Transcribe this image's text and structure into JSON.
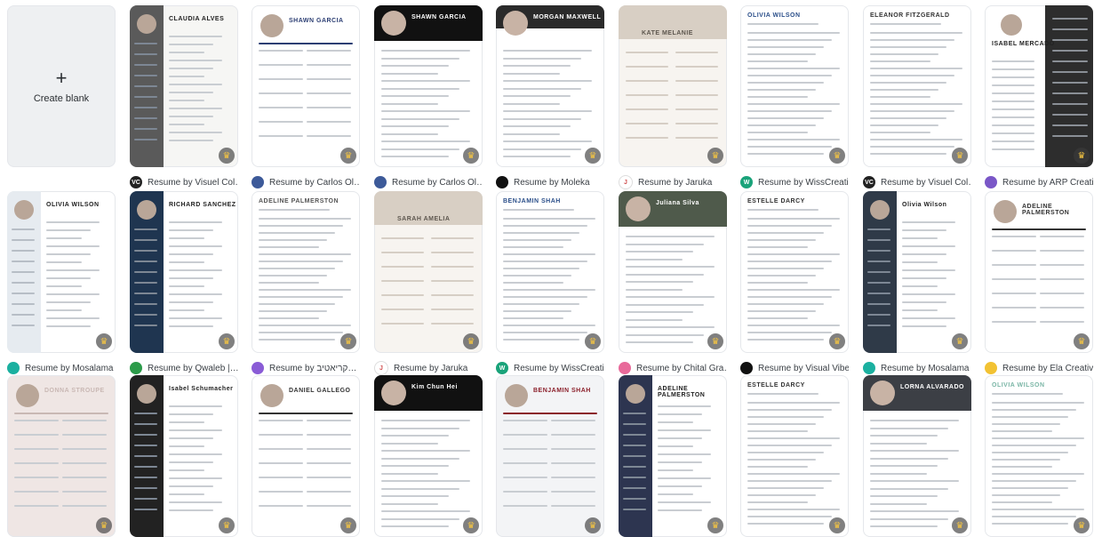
{
  "create_blank": {
    "plus": "+",
    "label": "Create blank"
  },
  "rows": [
    [
      {
        "caption": "Resume by Visuel Col…",
        "name": "CLAUDIA ALVES",
        "bg": "#f6f6f4",
        "accent": "#5a5a5a",
        "avatar": "#222222",
        "avatar_text": "VC",
        "layout": "left-dark"
      },
      {
        "caption": "Resume by Carlos Ol…",
        "name": "SHAWN GARCIA",
        "bg": "#ffffff",
        "accent": "#2c3e73",
        "avatar": "#3d5a99",
        "avatar_text": "",
        "layout": "top-photo"
      },
      {
        "caption": "Resume by Carlos Ol…",
        "name": "SHAWN GARCIA",
        "bg": "#ffffff",
        "accent": "#111111",
        "avatar": "#3d5a99",
        "avatar_text": "",
        "layout": "bold-black"
      },
      {
        "caption": "Resume by Moleka",
        "name": "MORGAN MAXWELL",
        "bg": "#ffffff",
        "accent": "#2a2a2a",
        "avatar": "#111111",
        "avatar_text": "",
        "layout": "top-bar"
      },
      {
        "caption": "Resume by Jaruka",
        "name": "KATE MELANIE",
        "bg": "#f7f4f0",
        "accent": "#d8cfc4",
        "avatar": "#ffffff",
        "avatar_text": "J",
        "layout": "soft"
      },
      {
        "caption": "Resume by WissCreati…",
        "name": "OLIVIA WILSON",
        "bg": "#ffffff",
        "accent": "#2b4f8a",
        "avatar": "#1aa37a",
        "avatar_text": "W",
        "layout": "plain"
      },
      {
        "caption": "Resume by Visuel Col…",
        "name": "ELEANOR FITZGERALD",
        "bg": "#ffffff",
        "accent": "#333333",
        "avatar": "#222222",
        "avatar_text": "VC",
        "layout": "plain"
      },
      {
        "caption": "Resume by ARP Creati…",
        "name": "ISABEL MERCADO",
        "bg": "#ffffff",
        "accent": "#2d2d2d",
        "avatar": "#7a57c7",
        "avatar_text": "",
        "layout": "right-dark"
      }
    ],
    [
      {
        "caption": "Resume by Mosalama",
        "name": "OLIVIA WILSON",
        "bg": "#ffffff",
        "accent": "#e6ebf0",
        "avatar": "#1bb0a0",
        "avatar_text": "",
        "layout": "left-light"
      },
      {
        "caption": "Resume by Qwaleb |…",
        "name": "RICHARD SANCHEZ",
        "bg": "#ffffff",
        "accent": "#1f3550",
        "avatar": "#2c9b4a",
        "avatar_text": "",
        "layout": "left-dark"
      },
      {
        "caption": "Resume by קריאטיב…",
        "name": "ADELINE PALMERSTON",
        "bg": "#ffffff",
        "accent": "#555555",
        "avatar": "#8a5cd6",
        "avatar_text": "",
        "layout": "plain"
      },
      {
        "caption": "Resume by Jaruka",
        "name": "SARAH AMELIA",
        "bg": "#f7f4f0",
        "accent": "#d8cfc4",
        "avatar": "#ffffff",
        "avatar_text": "J",
        "layout": "soft"
      },
      {
        "caption": "Resume by WissCreati…",
        "name": "BENJAMIN SHAH",
        "bg": "#ffffff",
        "accent": "#2b4f8a",
        "avatar": "#1aa37a",
        "avatar_text": "W",
        "layout": "plain"
      },
      {
        "caption": "Resume by Chital Gra…",
        "name": "Juliana Silva",
        "bg": "#ffffff",
        "accent": "#4f5a4b",
        "avatar": "#e86a9a",
        "avatar_text": "",
        "layout": "top-dark"
      },
      {
        "caption": "Resume by Visual Vibes",
        "name": "ESTELLE DARCY",
        "bg": "#ffffff",
        "accent": "#333333",
        "avatar": "#111111",
        "avatar_text": "",
        "layout": "plain"
      },
      {
        "caption": "Resume by Mosalama",
        "name": "Olivia Wilson",
        "bg": "#ffffff",
        "accent": "#2f3a48",
        "avatar": "#1bb0a0",
        "avatar_text": "",
        "layout": "left-dark"
      },
      {
        "caption": "Resume by Ela Creative",
        "name": "ADELINE PALMERSTON",
        "bg": "#ffffff",
        "accent": "#333333",
        "avatar": "#f2c233",
        "avatar_text": "",
        "layout": "top-photo"
      }
    ],
    [
      {
        "caption": "",
        "name": "DONNA STROUPE",
        "bg": "#efe6e4",
        "accent": "#c9b8b4",
        "avatar": "#999999",
        "avatar_text": "",
        "layout": "top-photo"
      },
      {
        "caption": "",
        "name": "Isabel Schumacher",
        "bg": "#ffffff",
        "accent": "#222222",
        "avatar": "#999999",
        "avatar_text": "",
        "layout": "left-dark"
      },
      {
        "caption": "",
        "name": "DANIEL GALLEGO",
        "bg": "#ffffff",
        "accent": "#333333",
        "avatar": "#999999",
        "avatar_text": "",
        "layout": "top-photo"
      },
      {
        "caption": "",
        "name": "Kim Chun Hei",
        "bg": "#ffffff",
        "accent": "#111111",
        "avatar": "#999999",
        "avatar_text": "",
        "layout": "top-dark"
      },
      {
        "caption": "",
        "name": "BENJAMIN SHAH",
        "bg": "#f3f4f6",
        "accent": "#8b1f2a",
        "avatar": "#999999",
        "avatar_text": "",
        "layout": "top-photo"
      },
      {
        "caption": "",
        "name": "ADELINE PALMERSTON",
        "bg": "#ffffff",
        "accent": "#2d3550",
        "avatar": "#999999",
        "avatar_text": "",
        "layout": "left-dark"
      },
      {
        "caption": "",
        "name": "ESTELLE DARCY",
        "bg": "#ffffff",
        "accent": "#333333",
        "avatar": "#999999",
        "avatar_text": "",
        "layout": "plain"
      },
      {
        "caption": "",
        "name": "LORNA ALVARADO",
        "bg": "#ffffff",
        "accent": "#3c3f45",
        "avatar": "#999999",
        "avatar_text": "",
        "layout": "top-dark"
      },
      {
        "caption": "",
        "name": "OLIVIA WILSON",
        "bg": "#ffffff",
        "accent": "#7bb6a6",
        "avatar": "#999999",
        "avatar_text": "",
        "layout": "plain"
      }
    ]
  ]
}
